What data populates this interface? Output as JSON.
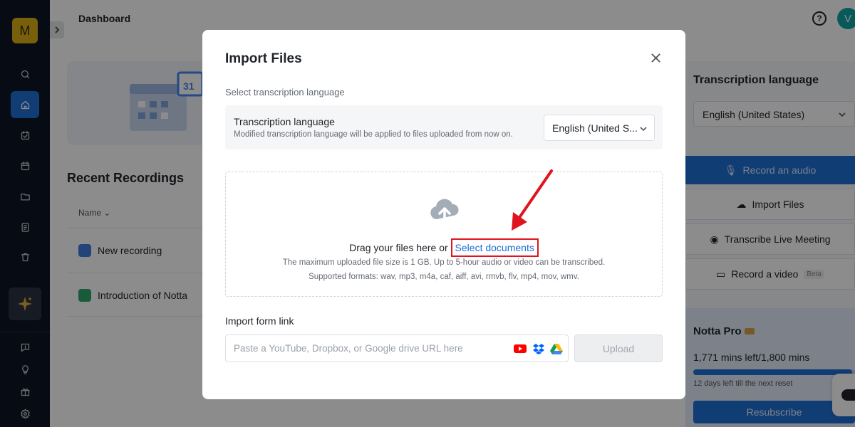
{
  "sidebar": {
    "logo_letter": "M",
    "nav_icons": [
      "search-icon",
      "home-icon",
      "calendar-check-icon",
      "calendar-icon",
      "folder-icon",
      "document-icon",
      "trash-icon"
    ],
    "bottom_icons": [
      "feedback-icon",
      "lightbulb-icon",
      "gift-icon",
      "settings-icon"
    ]
  },
  "header": {
    "title": "Dashboard",
    "help_symbol": "?",
    "avatar_letter": "V"
  },
  "main": {
    "recent_title": "Recent Recordings",
    "name_column": "Name",
    "recordings": [
      {
        "label": "New recording"
      },
      {
        "label": "Introduction of Notta"
      }
    ]
  },
  "right_panel": {
    "title": "Transcription language",
    "language": "English (United States)",
    "buttons": {
      "record_audio": "Record an audio",
      "import_files": "Import Files",
      "live_meeting": "Transcribe Live Meeting",
      "record_video": "Record a video",
      "beta": "Beta"
    },
    "pro": {
      "title": "Notta Pro",
      "minutes": "1,771 mins left/1,800 mins",
      "usage_fraction": 0.984,
      "reset": "12 days left till the next reset",
      "resubscribe": "Resubscribe"
    }
  },
  "modal": {
    "title": "Import Files",
    "subtitle": "Select transcription language",
    "lang_label": "Transcription language",
    "lang_hint": "Modified transcription language will be applied to files uploaded from now on.",
    "lang_value": "English (United S...",
    "drop_text": "Drag your files here or",
    "select_link": "Select documents",
    "size_note": "The maximum uploaded file size is 1 GB. Up to 5-hour audio or video can be transcribed.",
    "formats_note": "Supported formats: wav, mp3, m4a, caf, aiff, avi, rmvb, flv, mp4, mov, wmv.",
    "link_label": "Import form link",
    "url_placeholder": "Paste a YouTube, Dropbox, or Google drive URL here",
    "upload_label": "Upload"
  },
  "colors": {
    "accent": "#1f6fd6",
    "highlight_red": "#e0141e",
    "sidebar_bg": "#0e1726",
    "logo_bg": "#d9ad17"
  }
}
